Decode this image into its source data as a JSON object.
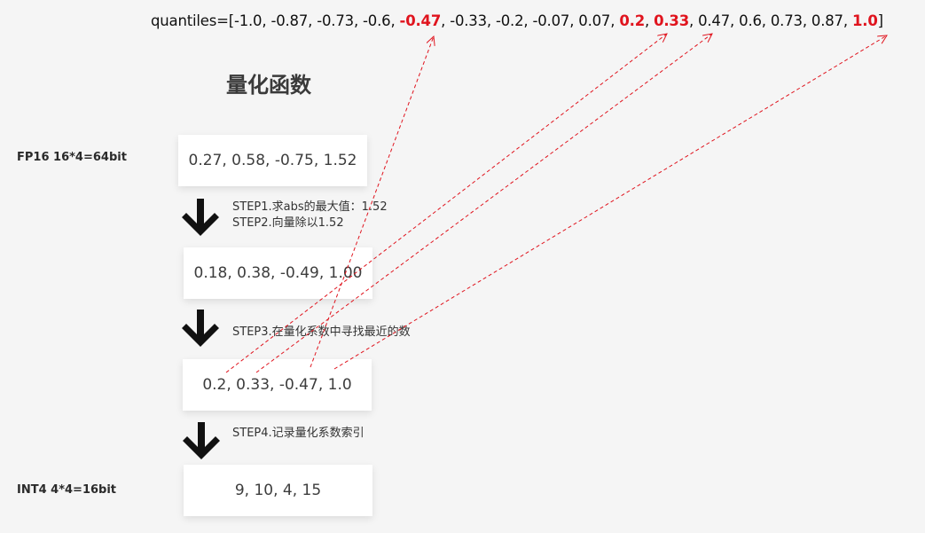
{
  "quantiles": {
    "prefix": "quantiles=[",
    "items": [
      {
        "text": "-1.0",
        "highlight": false
      },
      {
        "text": "-0.87",
        "highlight": false
      },
      {
        "text": "-0.73",
        "highlight": false
      },
      {
        "text": "-0.6",
        "highlight": false
      },
      {
        "text": "-0.47",
        "highlight": true
      },
      {
        "text": "-0.33",
        "highlight": false
      },
      {
        "text": "-0.2",
        "highlight": false
      },
      {
        "text": "-0.07",
        "highlight": false
      },
      {
        "text": "0.07",
        "highlight": false
      },
      {
        "text": "0.2",
        "highlight": true
      },
      {
        "text": "0.33",
        "highlight": true
      },
      {
        "text": "0.47",
        "highlight": false
      },
      {
        "text": "0.6",
        "highlight": false
      },
      {
        "text": "0.73",
        "highlight": false
      },
      {
        "text": "0.87",
        "highlight": false
      },
      {
        "text": "1.0",
        "highlight": true
      }
    ],
    "suffix": "]",
    "highlight_color": "#e0141e"
  },
  "title": "量化函数",
  "labels": {
    "fp16": "FP16 16*4=64bit",
    "int4": "INT4 4*4=16bit"
  },
  "boxes": {
    "input": "0.27, 0.58, -0.75, 1.52",
    "normalized": "0.18, 0.38, -0.49, 1.00",
    "nearest": "0.2, 0.33, -0.47, 1.0",
    "indices": "9, 10, 4, 15"
  },
  "steps": {
    "step1": "STEP1.求abs的最大值：1.52",
    "step2": "STEP2.向量除以1.52",
    "step3": "STEP3.在量化系数中寻找最近的数",
    "step4": "STEP4.记录量化系数索引"
  },
  "colors": {
    "background": "#f5f5f5",
    "link_line": "#e0141e",
    "arrow": "#111111"
  },
  "icons": {
    "down_arrow": "down-arrow-icon"
  }
}
